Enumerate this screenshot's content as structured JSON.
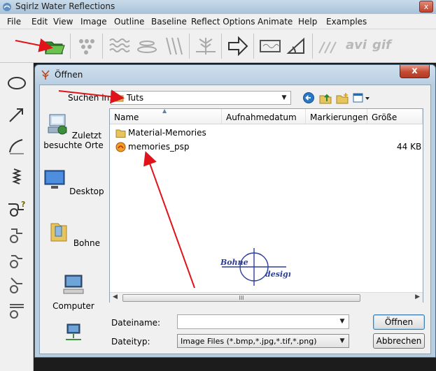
{
  "app": {
    "title": "Sqirlz Water Reflections",
    "close_label": "x",
    "menu": [
      "File",
      "Edit",
      "View",
      "Image",
      "Outline",
      "Baseline",
      "Reflect Options",
      "Animate",
      "Help",
      "Examples"
    ],
    "toolbar_text": {
      "avi": "avi",
      "gif": "gif"
    }
  },
  "dialog": {
    "title": "Öffnen",
    "close_label": "x",
    "look_in_label": "Suchen in:",
    "look_in_value": "Tuts",
    "places": [
      "Zuletzt besuchte Orte",
      "Desktop",
      "Bohne",
      "Computer"
    ],
    "columns": [
      "Name",
      "Aufnahmedatum",
      "Markierungen",
      "Größe"
    ],
    "files": [
      {
        "name": "Material-Memories",
        "size": ""
      },
      {
        "name": "memories_psp",
        "size": "44 KB"
      }
    ],
    "scroll_grip": "III",
    "watermark": {
      "left": "Bohne",
      "right": "design"
    },
    "filename_label": "Dateiname:",
    "filename_value": "",
    "filetype_label": "Dateityp:",
    "filetype_value": "Image Files (*.bmp,*.jpg,*.tif,*.png)",
    "open_button": "Öffnen",
    "cancel_button": "Abbrechen"
  },
  "colors": {
    "accent_arrow": "#e0131b",
    "title_bar": "#b9cfe2",
    "close_red": "#c44a32"
  }
}
